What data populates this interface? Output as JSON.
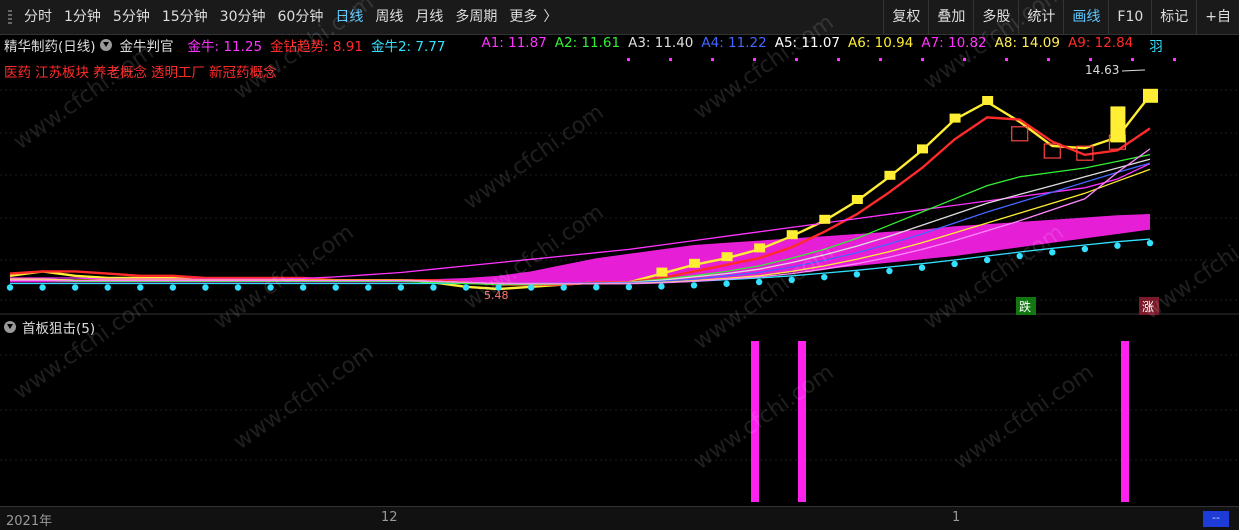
{
  "toolbar": {
    "tabs": [
      {
        "label": "分时",
        "active": false
      },
      {
        "label": "1分钟",
        "active": false
      },
      {
        "label": "5分钟",
        "active": false
      },
      {
        "label": "15分钟",
        "active": false
      },
      {
        "label": "30分钟",
        "active": false
      },
      {
        "label": "60分钟",
        "active": false
      },
      {
        "label": "日线",
        "active": true
      },
      {
        "label": "周线",
        "active": false
      },
      {
        "label": "月线",
        "active": false
      },
      {
        "label": "多周期",
        "active": false
      },
      {
        "label": "更多",
        "active": false
      }
    ],
    "more_arrow": "〉",
    "right_buttons": [
      {
        "label": "复权",
        "active": false
      },
      {
        "label": "叠加",
        "active": false
      },
      {
        "label": "多股",
        "active": false
      },
      {
        "label": "统计",
        "active": false
      },
      {
        "label": "画线",
        "active": true
      },
      {
        "label": "F10",
        "active": false
      },
      {
        "label": "标记",
        "active": false
      },
      {
        "label": "+自",
        "active": false
      }
    ]
  },
  "info_bar": {
    "stock_name": "精华制药(日线)",
    "indicator_name": "金牛判官",
    "values": [
      {
        "label": "金牛: 11.25",
        "color": "#ff33ff"
      },
      {
        "label": "金钻趋势: 8.91",
        "color": "#ff2b2b"
      },
      {
        "label": "金牛2: 7.77",
        "color": "#33e0ff"
      },
      {
        "label": "A1: 11.87",
        "color": "#ff33ff"
      },
      {
        "label": "A2: 11.61",
        "color": "#33ee33"
      },
      {
        "label": "A3: 11.40",
        "color": "#dddddd"
      },
      {
        "label": "A4: 11.22",
        "color": "#4466ff"
      },
      {
        "label": "A5: 11.07",
        "color": "#ffffff"
      },
      {
        "label": "A6: 10.94",
        "color": "#ffee33"
      },
      {
        "label": "A7: 10.82",
        "color": "#ff33ff"
      },
      {
        "label": "A8: 14.09",
        "color": "#ffee55"
      },
      {
        "label": "A9: 12.84",
        "color": "#ff2b2b"
      }
    ],
    "tail_text": "羽"
  },
  "tags": [
    "医药",
    "江苏板块",
    "养老概念",
    "透明工厂",
    "新冠药概念"
  ],
  "annotations": {
    "high_price": "14.63",
    "low_price": "5.48",
    "down_badge": "跌",
    "up_badge": "涨"
  },
  "indicator": {
    "title": "首板狙击(5)"
  },
  "time_axis": {
    "labels": [
      "2021年",
      "12",
      "1"
    ]
  },
  "scroll_button": "--",
  "watermark": "www.cfchi.com",
  "chart_data": {
    "type": "line",
    "price_ylim": [
      5.0,
      15.0
    ],
    "x_count": 36,
    "series": [
      {
        "name": "A8",
        "color": "#ffee33",
        "values": [
          6.1,
          6.3,
          6.1,
          6.0,
          6.0,
          6.0,
          5.9,
          5.9,
          5.9,
          5.9,
          5.9,
          5.9,
          5.9,
          5.8,
          5.6,
          5.5,
          5.6,
          5.7,
          5.8,
          5.8,
          6.2,
          6.6,
          6.9,
          7.3,
          7.9,
          8.6,
          9.5,
          10.6,
          11.8,
          13.2,
          14.0,
          13.1,
          12.0,
          11.9,
          12.4,
          14.3
        ]
      },
      {
        "name": "A9",
        "color": "#ff2b2b",
        "values": [
          6.2,
          6.3,
          6.3,
          6.2,
          6.1,
          6.1,
          6.0,
          6.0,
          6.0,
          6.0,
          5.9,
          5.9,
          5.9,
          5.9,
          5.8,
          5.7,
          5.7,
          5.7,
          5.8,
          5.8,
          6.0,
          6.3,
          6.6,
          6.9,
          7.4,
          8.1,
          8.9,
          9.9,
          11.0,
          12.3,
          13.3,
          13.2,
          12.2,
          11.6,
          11.8,
          12.8
        ]
      },
      {
        "name": "金牛",
        "color": "#ff33ff",
        "values": [
          6.0,
          6.0,
          6.0,
          5.95,
          5.95,
          5.95,
          5.95,
          5.95,
          5.95,
          5.98,
          6.05,
          6.15,
          6.25,
          6.4,
          6.55,
          6.7,
          6.85,
          7.0,
          7.15,
          7.3,
          7.5,
          7.7,
          7.9,
          8.1,
          8.3,
          8.5,
          8.7,
          8.9,
          9.1,
          9.3,
          9.5,
          9.7,
          9.9,
          10.1,
          10.5,
          11.2
        ]
      },
      {
        "name": "金牛2",
        "color": "#33e0ff",
        "values": [
          5.75,
          5.75,
          5.75,
          5.75,
          5.75,
          5.75,
          5.75,
          5.75,
          5.75,
          5.75,
          5.75,
          5.75,
          5.75,
          5.75,
          5.75,
          5.75,
          5.75,
          5.75,
          5.76,
          5.77,
          5.8,
          5.85,
          5.92,
          6.0,
          6.1,
          6.22,
          6.35,
          6.5,
          6.65,
          6.82,
          7.0,
          7.18,
          7.35,
          7.5,
          7.65,
          7.77
        ]
      },
      {
        "name": "A2",
        "color": "#33ee33",
        "values": [
          5.9,
          5.9,
          5.85,
          5.85,
          5.85,
          5.85,
          5.85,
          5.85,
          5.85,
          5.85,
          5.85,
          5.85,
          5.85,
          5.8,
          5.75,
          5.7,
          5.7,
          5.72,
          5.75,
          5.8,
          5.95,
          6.1,
          6.3,
          6.55,
          6.9,
          7.3,
          7.8,
          8.4,
          9.0,
          9.6,
          10.2,
          10.6,
          10.8,
          11.0,
          11.3,
          11.61
        ]
      },
      {
        "name": "A3",
        "color": "#dddddd",
        "values": [
          5.95,
          5.95,
          5.9,
          5.9,
          5.9,
          5.9,
          5.9,
          5.9,
          5.9,
          5.9,
          5.9,
          5.9,
          5.9,
          5.85,
          5.8,
          5.75,
          5.75,
          5.76,
          5.78,
          5.8,
          5.9,
          6.05,
          6.2,
          6.4,
          6.7,
          7.05,
          7.45,
          7.9,
          8.4,
          8.9,
          9.4,
          9.8,
          10.2,
          10.6,
          11.0,
          11.4
        ]
      },
      {
        "name": "A4",
        "color": "#4466ff",
        "values": [
          5.95,
          5.95,
          5.9,
          5.9,
          5.9,
          5.9,
          5.9,
          5.9,
          5.9,
          5.9,
          5.9,
          5.9,
          5.9,
          5.85,
          5.8,
          5.75,
          5.75,
          5.76,
          5.77,
          5.78,
          5.85,
          5.95,
          6.1,
          6.25,
          6.5,
          6.8,
          7.15,
          7.55,
          8.0,
          8.5,
          9.0,
          9.45,
          9.9,
          10.35,
          10.8,
          11.22
        ]
      },
      {
        "name": "A6",
        "color": "#ffee33",
        "values": [
          5.95,
          5.95,
          5.9,
          5.9,
          5.9,
          5.9,
          5.9,
          5.9,
          5.9,
          5.9,
          5.9,
          5.9,
          5.9,
          5.85,
          5.8,
          5.75,
          5.74,
          5.74,
          5.74,
          5.75,
          5.8,
          5.88,
          5.98,
          6.1,
          6.3,
          6.55,
          6.85,
          7.2,
          7.6,
          8.05,
          8.5,
          8.95,
          9.4,
          9.85,
          10.4,
          10.94
        ]
      },
      {
        "name": "A1",
        "color": "#ff88ff",
        "values": [
          5.9,
          5.9,
          5.88,
          5.88,
          5.88,
          5.88,
          5.88,
          5.88,
          5.88,
          5.88,
          5.88,
          5.88,
          5.88,
          5.85,
          5.8,
          5.75,
          5.74,
          5.74,
          5.74,
          5.74,
          5.78,
          5.85,
          5.95,
          6.05,
          6.2,
          6.4,
          6.65,
          6.95,
          7.3,
          7.7,
          8.15,
          8.6,
          9.1,
          9.6,
          10.8,
          11.87
        ]
      }
    ],
    "band": {
      "name": "金钻趋势",
      "color": "#ff22ee",
      "lower": [
        5.8,
        5.8,
        5.8,
        5.8,
        5.8,
        5.8,
        5.8,
        5.8,
        5.8,
        5.8,
        5.8,
        5.8,
        5.8,
        5.8,
        5.75,
        5.72,
        5.72,
        5.74,
        5.77,
        5.8,
        5.85,
        5.9,
        6.0,
        6.1,
        6.25,
        6.4,
        6.55,
        6.7,
        6.85,
        7.0,
        7.2,
        7.4,
        7.6,
        7.8,
        8.0,
        8.2
      ],
      "upper": [
        5.9,
        5.9,
        5.9,
        5.9,
        5.9,
        5.9,
        5.9,
        5.9,
        5.9,
        5.9,
        5.9,
        5.9,
        5.9,
        5.95,
        6.0,
        6.1,
        6.3,
        6.6,
        6.9,
        7.1,
        7.3,
        7.5,
        7.6,
        7.7,
        7.8,
        7.9,
        8.0,
        8.1,
        8.2,
        8.35,
        8.45,
        8.55,
        8.65,
        8.75,
        8.85,
        8.91
      ]
    },
    "signal_bars_x": [
      20,
      22,
      33
    ]
  }
}
